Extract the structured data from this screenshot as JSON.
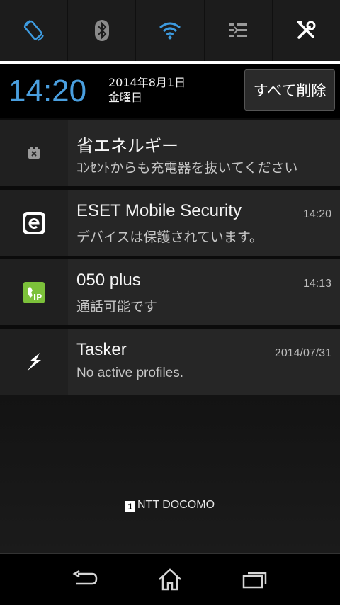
{
  "quick_settings": {
    "tiles": [
      {
        "name": "auto-rotate",
        "icon": "screen-rotation-icon",
        "color": "#3d9be0"
      },
      {
        "name": "bluetooth",
        "icon": "bluetooth-icon",
        "color": "#8a8a8a"
      },
      {
        "name": "wifi",
        "icon": "wifi-icon",
        "color": "#3d9be0"
      },
      {
        "name": "sound",
        "icon": "sound-settings-icon",
        "color": "#9a9a9a"
      },
      {
        "name": "settings",
        "icon": "tools-icon",
        "color": "#ffffff"
      }
    ]
  },
  "header": {
    "time": "14:20",
    "date_line1": "2014年8月1日",
    "date_line2": "金曜日",
    "clear_all": "すべて削除"
  },
  "notifications": [
    {
      "app_icon": "battery-saver-icon",
      "title": "省エネルギー",
      "text": "ｺﾝｾﾝﾄからも充電器を抜いてください",
      "time": ""
    },
    {
      "app_icon": "eset-icon",
      "title": "ESET Mobile Security",
      "text": "デバイスは保護されています。",
      "time": "14:20"
    },
    {
      "app_icon": "050-plus-icon",
      "title": "050 plus",
      "text": "通話可能です",
      "time": "14:13"
    },
    {
      "app_icon": "tasker-icon",
      "title": "Tasker",
      "text": "No active profiles.",
      "time": "2014/07/31"
    }
  ],
  "carrier": {
    "sim_slot": "1",
    "name": "NTT DOCOMO"
  },
  "navbar": {
    "back": "back-icon",
    "home": "home-icon",
    "recents": "recents-icon"
  }
}
